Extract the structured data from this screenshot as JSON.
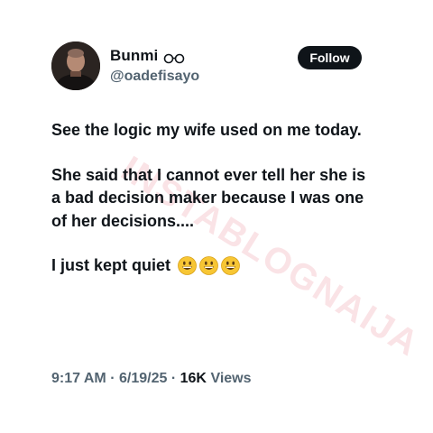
{
  "author": {
    "name": "Bunmi",
    "handle": "@oadefisayo",
    "avatar_icon": "profile-photo",
    "badge_icon": "glasses-emoji"
  },
  "follow_button": {
    "label": "Follow"
  },
  "tweet": {
    "paragraphs": [
      "See the logic my wife used on me today.",
      "She said that I cannot ever tell her she is a bad decision maker because I was one of her decisions....",
      "I just kept quiet"
    ],
    "emojis": [
      "grinning-face-emoji",
      "grinning-face-emoji",
      "grinning-face-emoji"
    ]
  },
  "watermark": {
    "text": "INSTABLOGNAIJA"
  },
  "meta": {
    "time": "9:17 AM",
    "separator": "·",
    "date": "6/19/25",
    "views_count": "16K",
    "views_label": "Views"
  },
  "colors": {
    "text_primary": "#0f1419",
    "text_secondary": "#536471",
    "button_bg": "#0f1419",
    "watermark": "#dc283c"
  }
}
